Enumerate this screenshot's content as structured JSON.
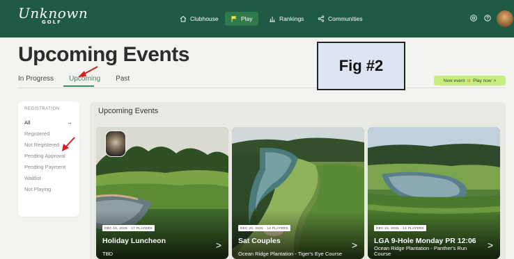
{
  "nav": {
    "logo_script": "Unknown",
    "logo_sub": "GOLF",
    "items": [
      {
        "label": "Clubhouse",
        "icon": "home-icon"
      },
      {
        "label": "Play",
        "icon": "flag-icon",
        "active": true
      },
      {
        "label": "Rankings",
        "icon": "bar-chart-icon"
      },
      {
        "label": "Communities",
        "icon": "share-icon"
      }
    ],
    "right_icons": [
      "settings-icon",
      "help-icon",
      "avatar"
    ]
  },
  "header": {
    "title": "Upcoming Events",
    "tabs": [
      {
        "label": "In Progress"
      },
      {
        "label": "Upcoming",
        "active": true
      },
      {
        "label": "Past"
      }
    ],
    "cta": {
      "left": "New event",
      "or": "or",
      "right": "Play now",
      "chevron": ">"
    }
  },
  "annotation": {
    "fig_label": "Fig #2",
    "arrow_color": "#d42020"
  },
  "sidebar": {
    "heading": "REGISTRATION",
    "items": [
      {
        "label": "All",
        "active": true,
        "arrow": "→"
      },
      {
        "label": "Registered"
      },
      {
        "label": "Not Registered"
      },
      {
        "label": "Pending Approval"
      },
      {
        "label": "Pending Payment"
      },
      {
        "label": "Waitlist"
      },
      {
        "label": "Not Playing"
      }
    ]
  },
  "events": {
    "section_title": "Upcoming Events",
    "cards": [
      {
        "badge": "DEC 10, 2025 · 17 PLAYERS",
        "title": "Holiday Luncheon",
        "subtitle": "TBD",
        "chevron": ">"
      },
      {
        "badge": "DEC 20, 2025 · 14 PLAYERS",
        "title": "Sat Couples",
        "subtitle": "Ocean Ridge Plantation - Tiger's Eye Course",
        "chevron": ">"
      },
      {
        "badge": "DEC 22, 2025 · 13 PLAYERS",
        "title": "LGA 9-Hole Monday PR 12:06",
        "subtitle": "Ocean Ridge Plantation - Panther's Run Course",
        "chevron": ">"
      }
    ]
  },
  "colors": {
    "nav_bg": "#1f5a44",
    "accent_green": "#3d8a5a",
    "cta_bg": "#c9ec7e",
    "page_bg": "#f3f4ef"
  }
}
